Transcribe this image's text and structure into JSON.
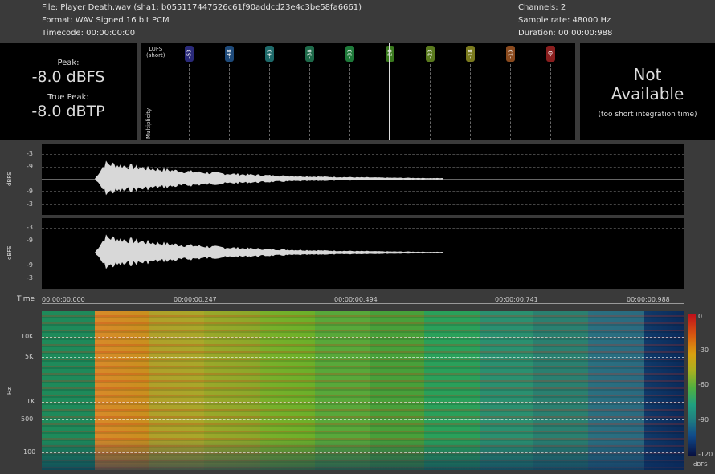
{
  "header": {
    "file_line": "File: Player Death.wav (sha1: b055117447526c61f90addcd23e4c3be58fa6661)",
    "format_line": "Format: WAV Signed 16 bit PCM",
    "timecode_line": "Timecode:  00:00:00:00",
    "channels_line": "Channels: 2",
    "samplerate_line": "Sample rate: 48000 Hz",
    "duration_line": "Duration:  00:00:00:988"
  },
  "peak": {
    "peak_label": "Peak:",
    "peak_value": "-8.0 dBFS",
    "true_peak_label": "True Peak:",
    "true_peak_value": "-8.0 dBTP"
  },
  "lufs": {
    "title_line1": "LUFS",
    "title_line2": "(short)",
    "multiplicity_label": "Multiplicity",
    "marks": [
      {
        "label": "-53",
        "color": "#2a2a7a"
      },
      {
        "label": "-48",
        "color": "#1e4a7a"
      },
      {
        "label": "-43",
        "color": "#1e6a6a"
      },
      {
        "label": "-38",
        "color": "#1e6a4a"
      },
      {
        "label": "-33",
        "color": "#1e7a3a"
      },
      {
        "label": "-28",
        "color": "#3a7a1e"
      },
      {
        "label": "-23",
        "color": "#5a7a1e"
      },
      {
        "label": "-18",
        "color": "#7a7a1e"
      },
      {
        "label": "-13",
        "color": "#8a4a1e"
      },
      {
        "label": "-8",
        "color": "#8a1e1e"
      }
    ],
    "current_lufs": -28
  },
  "integrated": {
    "line1": "Not",
    "line2": "Available",
    "note": "(too short integration time)"
  },
  "waveform": {
    "ylabel": "dBFS",
    "ticks": [
      "-3",
      "-9",
      "-9",
      "-3"
    ]
  },
  "time_axis": {
    "label": "Time",
    "ticks": [
      "00:00:00.000",
      "00:00:00.247",
      "00:00:00.494",
      "00:00:00.741",
      "00:00:00.988"
    ]
  },
  "spectrogram": {
    "ylabel": "Hz",
    "freq_ticks": [
      "10K",
      "5K",
      "1K",
      "500",
      "100"
    ],
    "colorbar_ticks": [
      "0",
      "-30",
      "-60",
      "-90",
      "-120"
    ],
    "colorbar_label": "dBFS"
  }
}
